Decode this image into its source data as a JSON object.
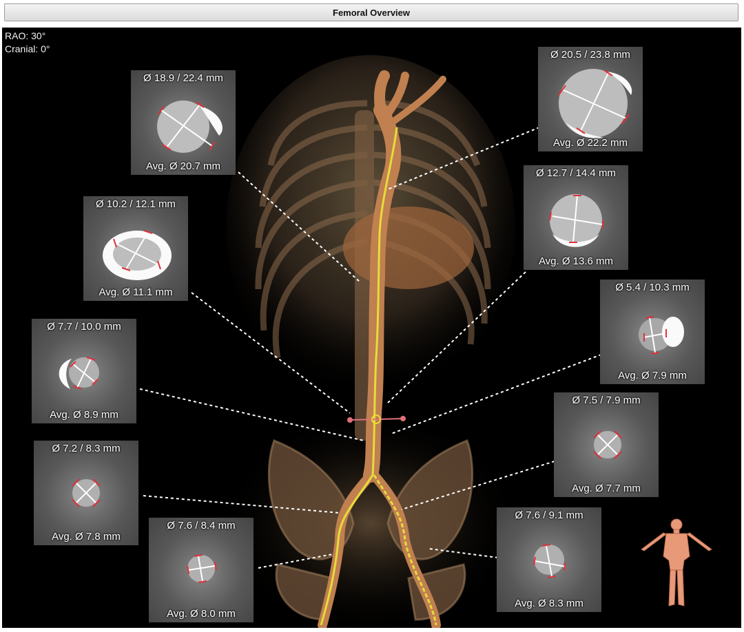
{
  "title": "Femoral Overview",
  "orientation": {
    "rao": "RAO: 30°",
    "cranial": "Cranial: 0°"
  },
  "colors": {
    "centerline": "#e6dc3a",
    "measure_tick": "#e0303a",
    "vessel": "#b87a4a"
  },
  "icons": {
    "body_model": "body-model-icon"
  },
  "measurements": [
    {
      "id": "m1",
      "diameters": "Ø 18.9 / 22.4 mm",
      "average": "Avg. Ø 20.7 mm"
    },
    {
      "id": "m2",
      "diameters": "Ø 20.5 / 23.8 mm",
      "average": "Avg. Ø 22.2 mm"
    },
    {
      "id": "m3",
      "diameters": "Ø 10.2 / 12.1 mm",
      "average": "Avg. Ø 11.1 mm"
    },
    {
      "id": "m4",
      "diameters": "Ø 12.7 / 14.4 mm",
      "average": "Avg. Ø 13.6 mm"
    },
    {
      "id": "m5",
      "diameters": "Ø 5.4 / 10.3 mm",
      "average": "Avg. Ø 7.9 mm"
    },
    {
      "id": "m6",
      "diameters": "Ø 7.7 / 10.0 mm",
      "average": "Avg. Ø 8.9 mm"
    },
    {
      "id": "m7",
      "diameters": "Ø 7.5 / 7.9 mm",
      "average": "Avg. Ø 7.7 mm"
    },
    {
      "id": "m8",
      "diameters": "Ø 7.2 / 8.3 mm",
      "average": "Avg. Ø 7.8 mm"
    },
    {
      "id": "m9",
      "diameters": "Ø 7.6 / 8.4 mm",
      "average": "Avg. Ø 8.0 mm"
    },
    {
      "id": "m10",
      "diameters": "Ø 7.6 / 9.1 mm",
      "average": "Avg. Ø 8.3 mm"
    }
  ]
}
